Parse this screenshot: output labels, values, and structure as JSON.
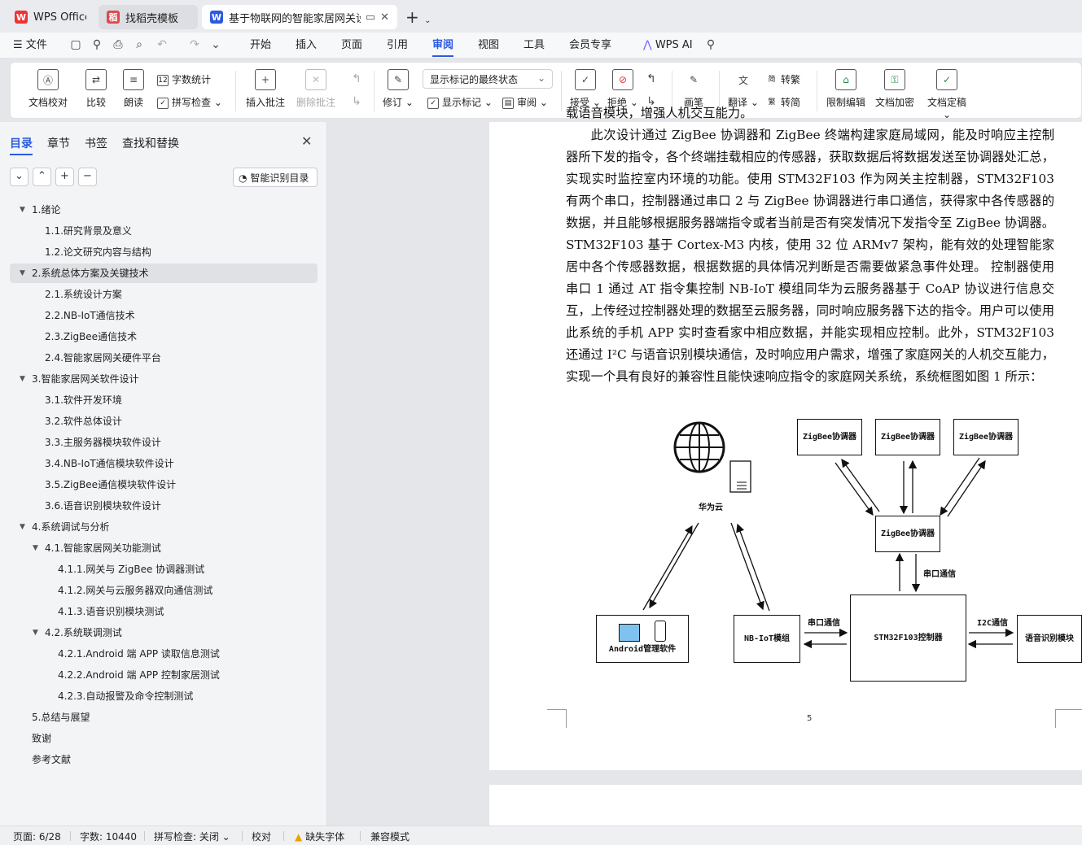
{
  "tabs": [
    {
      "label": "WPS Office"
    },
    {
      "label": "找稻壳模板"
    },
    {
      "label": "基于物联网的智能家居网关设计"
    }
  ],
  "menu": {
    "file": "文件",
    "items": [
      "开始",
      "插入",
      "页面",
      "引用",
      "审阅",
      "视图",
      "工具",
      "会员专享"
    ],
    "active": "审阅",
    "ai": "WPS AI"
  },
  "ribbon": {
    "doc_check": "文档校对",
    "compare": "比较",
    "read_aloud": "朗读",
    "word_count": "字数统计",
    "spell_check": "拼写检查",
    "insert_comment": "插入批注",
    "delete_comment": "删除批注",
    "revise": "修订",
    "markup_state": "显示标记的最终状态",
    "show_markup": "显示标记",
    "review": "审阅",
    "accept": "接受",
    "reject": "拒绝",
    "pen": "画笔",
    "translate": "翻译",
    "to_traditional": "转繁",
    "to_simplified": "转简",
    "restrict_edit": "限制编辑",
    "doc_encrypt": "文档加密",
    "doc_finalize": "文档定稿"
  },
  "panel": {
    "tabs": [
      "目录",
      "章节",
      "书签",
      "查找和替换"
    ],
    "smart_toc": "智能识别目录",
    "toc": [
      {
        "label": "1.绪论",
        "level": 1,
        "expanded": true
      },
      {
        "label": "1.1.研究背景及意义",
        "level": 2
      },
      {
        "label": "1.2.论文研究内容与结构",
        "level": 2
      },
      {
        "label": "2.系统总体方案及关键技术",
        "level": 1,
        "expanded": true,
        "selected": true
      },
      {
        "label": "2.1.系统设计方案",
        "level": 2
      },
      {
        "label": "2.2.NB-IoT通信技术",
        "level": 2
      },
      {
        "label": "2.3.ZigBee通信技术",
        "level": 2
      },
      {
        "label": "2.4.智能家居网关硬件平台",
        "level": 2
      },
      {
        "label": "3.智能家居网关软件设计",
        "level": 1,
        "expanded": true
      },
      {
        "label": "3.1.软件开发环境",
        "level": 2
      },
      {
        "label": "3.2.软件总体设计",
        "level": 2
      },
      {
        "label": "3.3.主服务器模块软件设计",
        "level": 2
      },
      {
        "label": "3.4.NB-IoT通信模块软件设计",
        "level": 2
      },
      {
        "label": "3.5.ZigBee通信模块软件设计",
        "level": 2
      },
      {
        "label": "3.6.语音识别模块软件设计",
        "level": 2
      },
      {
        "label": "4.系统调试与分析",
        "level": 1,
        "expanded": true
      },
      {
        "label": "4.1.智能家居网关功能测试",
        "level": 2,
        "expanded": true
      },
      {
        "label": "4.1.1.网关与 ZigBee 协调器测试",
        "level": 3
      },
      {
        "label": "4.1.2.网关与云服务器双向通信测试",
        "level": 3
      },
      {
        "label": "4.1.3.语音识别模块测试",
        "level": 3
      },
      {
        "label": "4.2.系统联调测试",
        "level": 2,
        "expanded": true
      },
      {
        "label": "4.2.1.Android 端 APP 读取信息测试",
        "level": 3
      },
      {
        "label": "4.2.2.Android 端 APP 控制家居测试",
        "level": 3
      },
      {
        "label": "4.2.3.自动报警及命令控制测试",
        "level": 3
      },
      {
        "label": "5.总结与展望",
        "level": 1
      },
      {
        "label": "致谢",
        "level": 1
      },
      {
        "label": "参考文献",
        "level": 1
      }
    ]
  },
  "document": {
    "top_line": "载语音模块，增强人机交互能力。",
    "paragraph": "此次设计通过 ZigBee 协调器和 ZigBee 终端构建家庭局域网，能及时响应主控制器所下发的指令，各个终端挂载相应的传感器，获取数据后将数据发送至协调器处汇总，实现实时监控室内环境的功能。使用 STM32F103 作为网关主控制器，STM32F103 有两个串口，控制器通过串口 2 与 ZigBee 协调器进行串口通信，获得家中各传感器的数据，并且能够根据服务器端指令或者当前是否有突发情况下发指令至 ZigBee 协调器。STM32F103 基于 Cortex-M3 内核，使用 32 位 ARMv7 架构，能有效的处理智能家居中各个传感器数据，根据数据的具体情况判断是否需要做紧急事件处理。 控制器使用串口 1 通过 AT 指令集控制 NB-IoT 模组同华为云服务器基于 CoAP 协议进行信息交互，上传经过控制器处理的数据至云服务器，同时响应服务器下达的指令。用户可以使用此系统的手机 APP 实时查看家中相应数据，并能实现相应控制。此外，STM32F103 还通过 I²C 与语音识别模块通信，及时响应用户需求，增强了家庭网关的人机交互能力，实现一个具有良好的兼容性且能快速响应指令的家庭网关系统，系统框图如图 1 所示：",
    "page_number": "5"
  },
  "diagram": {
    "cloud": "华为云",
    "zigbee_top": [
      "ZigBee协调器",
      "ZigBee协调器",
      "ZigBee协调器"
    ],
    "zigbee_mid": "ZigBee协调器",
    "serial_label_v": "串口通信",
    "serial_label_h": "串口通信",
    "i2c_label": "I2C通信",
    "android": "Android管理软件",
    "nbiot": "NB-IoT模组",
    "stm32": "STM32F103控制器",
    "voice": "语音识别模块"
  },
  "status": {
    "page": "页面: 6/28",
    "words": "字数: 10440",
    "spell": "拼写检查: 关闭",
    "proof": "校对",
    "missing_font": "缺失字体",
    "compat": "兼容模式"
  }
}
